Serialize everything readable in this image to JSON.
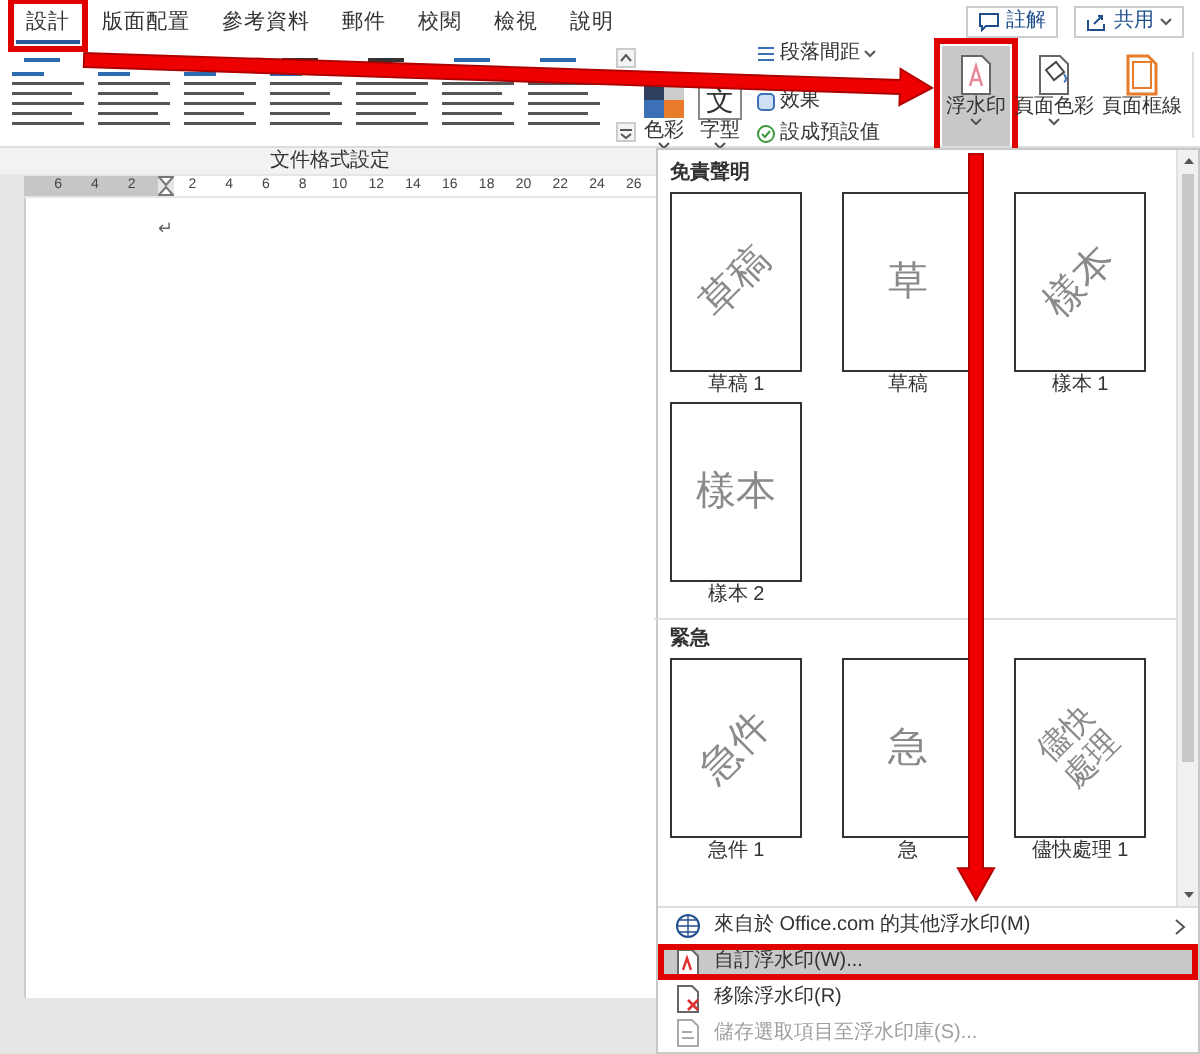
{
  "tabs": [
    {
      "label": "設計",
      "selected": true,
      "highlighted": true
    },
    {
      "label": "版面配置",
      "selected": false,
      "highlighted": false
    },
    {
      "label": "參考資料",
      "selected": false,
      "highlighted": false
    },
    {
      "label": "郵件",
      "selected": false,
      "highlighted": false
    },
    {
      "label": "校閱",
      "selected": false,
      "highlighted": false
    },
    {
      "label": "檢視",
      "selected": false,
      "highlighted": false
    },
    {
      "label": "說明",
      "selected": false,
      "highlighted": false
    }
  ],
  "header_buttons": [
    {
      "label": "註解",
      "kind": "comment",
      "has_menu": false
    },
    {
      "label": "共用",
      "kind": "share",
      "has_menu": true
    }
  ],
  "ribbon": {
    "big_buttons": [
      {
        "label": "色彩",
        "kind": "colors",
        "has_menu": true
      },
      {
        "label": "字型",
        "kind": "fonts",
        "glyph": "文",
        "has_menu": true
      }
    ],
    "small_buttons": [
      {
        "label": "段落間距",
        "kind": "spacing",
        "has_menu": true
      },
      {
        "label": "效果",
        "kind": "effects",
        "has_menu": false
      },
      {
        "label": "設成預設值",
        "kind": "default",
        "has_menu": false
      }
    ],
    "page_buttons": [
      {
        "label": "浮水印",
        "kind": "watermark",
        "pressed": true,
        "highlighted": true,
        "has_menu": true
      },
      {
        "label": "頁面色彩",
        "kind": "page-color",
        "pressed": false,
        "highlighted": false,
        "has_menu": true
      },
      {
        "label": "頁面框線",
        "kind": "page-borders",
        "pressed": false,
        "highlighted": false,
        "has_menu": false
      }
    ],
    "group_label": "文件格式設定"
  },
  "ruler": {
    "left_ticks": [
      "6",
      "4",
      "2"
    ],
    "right_ticks": [
      "2",
      "4",
      "6",
      "8",
      "10",
      "12",
      "14",
      "16",
      "18",
      "20",
      "22",
      "24",
      "26"
    ]
  },
  "document": {
    "paragraph_mark": "↵"
  },
  "watermark_menu": {
    "sections": [
      {
        "title": "免責聲明",
        "items": [
          {
            "label": "草稿 1",
            "text": "草稿",
            "kind": "diagonal"
          },
          {
            "label": "草稿",
            "text": "草",
            "kind": "horizontal"
          },
          {
            "label": "樣本 1",
            "text": "樣本",
            "kind": "diagonal"
          },
          {
            "label": "樣本 2",
            "text": "樣本",
            "kind": "horizontal"
          }
        ]
      },
      {
        "title": "緊急",
        "items": [
          {
            "label": "急件 1",
            "text": "急件",
            "kind": "diagonal"
          },
          {
            "label": "急",
            "text": "急",
            "kind": "horizontal"
          },
          {
            "label": "儘快處理 1",
            "text": "儘快處理",
            "kind": "diagonal"
          }
        ]
      }
    ],
    "commands": [
      {
        "label": "來自於 Office.com 的其他浮水印(M)",
        "kind": "online",
        "submenu": true,
        "disabled": false,
        "highlighted": false
      },
      {
        "label": "自訂浮水印(W)...",
        "kind": "custom",
        "submenu": false,
        "disabled": false,
        "highlighted": true
      },
      {
        "label": "移除浮水印(R)",
        "kind": "remove",
        "submenu": false,
        "disabled": false,
        "highlighted": false
      },
      {
        "label": "儲存選取項目至浮水印庫(S)...",
        "kind": "save",
        "submenu": false,
        "disabled": true,
        "highlighted": false
      }
    ]
  }
}
